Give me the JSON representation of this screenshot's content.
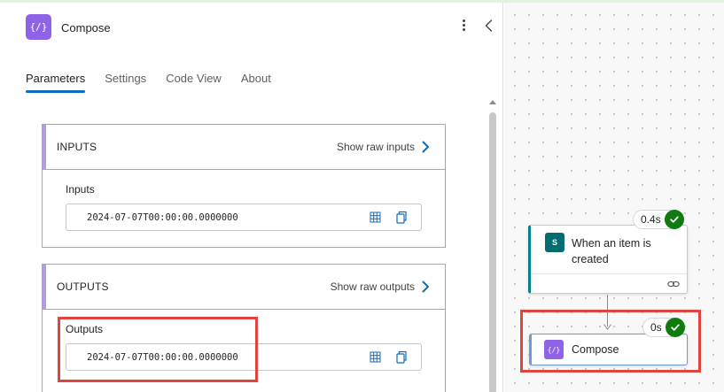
{
  "panel": {
    "title": "Compose",
    "icon": "compose-icon",
    "icon_glyph": "{/}",
    "tabs": [
      {
        "label": "Parameters",
        "active": true
      },
      {
        "label": "Settings",
        "active": false
      },
      {
        "label": "Code View",
        "active": false
      },
      {
        "label": "About",
        "active": false
      }
    ]
  },
  "inputs": {
    "title": "INPUTS",
    "raw_link": "Show raw inputs",
    "field_label": "Inputs",
    "field_value": "2024-07-07T00:00:00.0000000"
  },
  "outputs": {
    "title": "OUTPUTS",
    "raw_link": "Show raw outputs",
    "field_label": "Outputs",
    "field_value": "2024-07-07T00:00:00.0000000"
  },
  "flow": {
    "trigger": {
      "title": "When an item is created",
      "duration": "0.4s",
      "icon_text": "S",
      "status": "succeeded"
    },
    "action": {
      "title": "Compose",
      "duration": "0s",
      "icon_glyph": "{/}",
      "status": "succeeded"
    }
  },
  "colors": {
    "accent": "#0f6cbd",
    "compose_purple": "#8e63e8",
    "sharepoint_teal": "#036c70",
    "success_green": "#107c10",
    "highlight_red": "#e0453d"
  }
}
